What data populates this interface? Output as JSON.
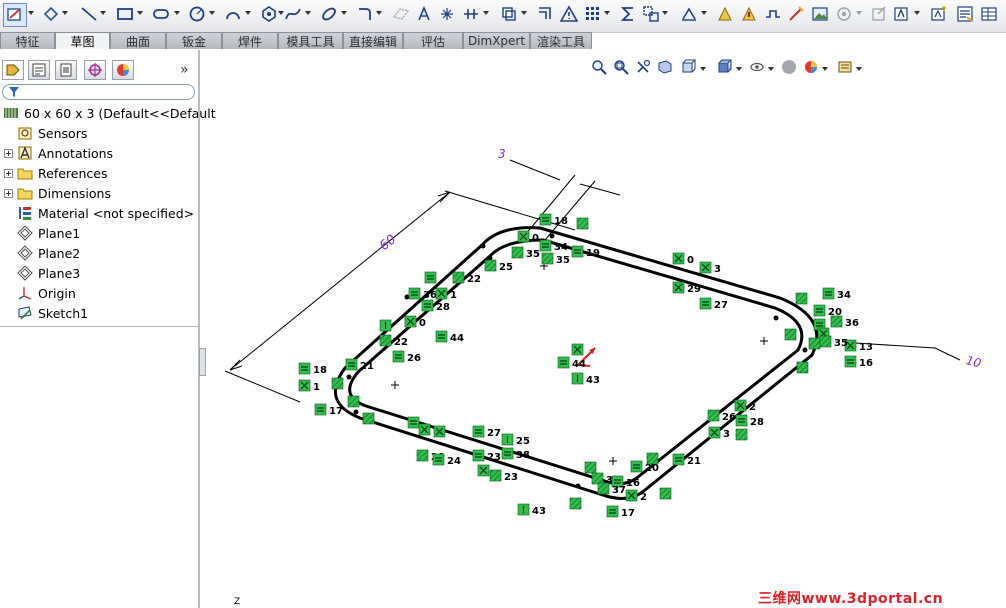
{
  "tabs": [
    "特征",
    "草图",
    "曲面",
    "钣金",
    "焊件",
    "模具工具",
    "直接编辑",
    "评估",
    "DimXpert",
    "渲染工具"
  ],
  "active_tab": "草图",
  "feature_tree": {
    "root": "60 x 60 x 3  (Default<<Default",
    "items": [
      {
        "label": "Sensors",
        "icon": "sensors-icon"
      },
      {
        "label": "Annotations",
        "icon": "annotations-icon"
      },
      {
        "label": "References",
        "icon": "folder-icon"
      },
      {
        "label": "Dimensions",
        "icon": "folder-icon"
      },
      {
        "label": "Material <not specified>",
        "icon": "material-icon"
      },
      {
        "label": "Plane1",
        "icon": "plane-icon"
      },
      {
        "label": "Plane2",
        "icon": "plane-icon"
      },
      {
        "label": "Plane3",
        "icon": "plane-icon"
      },
      {
        "label": "Origin",
        "icon": "origin-icon"
      },
      {
        "label": "Sketch1",
        "icon": "sketch-icon"
      }
    ]
  },
  "dimensions": {
    "d60": "60",
    "d3": "3",
    "d10": "10"
  },
  "relation_labels": {
    "l18a": "18",
    "l0a": "0",
    "l35a": "35",
    "l34a": "34",
    "l19": "19",
    "l35b": "35",
    "l0b": "0",
    "l3a": "3",
    "l29a": "29",
    "l27a": "27",
    "l22a": "22",
    "l25a": "25",
    "l36a": "36",
    "l1a": "1",
    "l28a": "28",
    "l0c": "0",
    "l44a": "44",
    "l22b": "22",
    "l26a": "26",
    "l18b": "18",
    "l21a": "21",
    "l1b": "1",
    "l17a": "17",
    "l34b": "34",
    "l20a": "20",
    "l36b": "36",
    "l13": "13",
    "l35c": "35",
    "l16a": "16",
    "l44b": "44",
    "l43a": "43",
    "l2a": "2",
    "l28b": "28",
    "l26b": "26",
    "l3b": "3",
    "l27b": "27",
    "l25b": "25",
    "l38": "38",
    "l23a": "23",
    "l29b": "29",
    "l24": "24",
    "l23b": "23",
    "l43b": "43",
    "l20b": "20",
    "l21b": "21",
    "l37a": "37",
    "l16b": "16",
    "l37b": "37",
    "l2b": "2",
    "l17b": "17"
  },
  "axis_label": "Z",
  "watermark": "三维网www.3dportal.cn",
  "colors": {
    "relation_fill": "#2fbf4a",
    "dimension_text": "#8a2be2",
    "accent": "#6d8fbf"
  }
}
